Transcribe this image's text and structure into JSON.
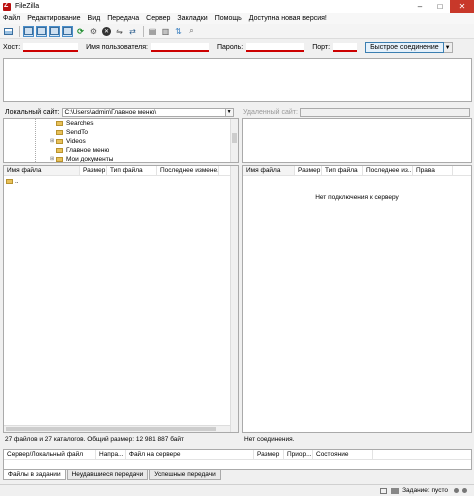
{
  "window": {
    "title": "FileZilla",
    "controls": [
      "–",
      "□",
      "✕"
    ]
  },
  "menu": [
    "Файл",
    "Редактирование",
    "Вид",
    "Передача",
    "Сервер",
    "Закладки",
    "Помощь",
    "Доступна новая версия!"
  ],
  "toolbar": {
    "icons": [
      "site-manager-icon",
      "message-log-icon",
      "local-tree-icon",
      "remote-tree-icon",
      "transfer-queue-icon",
      "refresh-icon",
      "process-queue-icon",
      "cancel-icon",
      "disconnect-icon",
      "reconnect-icon",
      "filter-icon",
      "compare-icon",
      "sync-browse-icon",
      "search-icon"
    ]
  },
  "quickconnect": {
    "host_label": "Хост:",
    "user_label": "Имя пользователя:",
    "pass_label": "Пароль:",
    "port_label": "Порт:",
    "host_value": "",
    "user_value": "",
    "pass_value": "",
    "port_value": "",
    "button_label": "Быстрое соединение",
    "highlight_color": "#cc0000"
  },
  "local": {
    "site_label": "Локальный сайт:",
    "site_path": "C:\\Users\\admin\\Главное меню\\",
    "tree": [
      "Searches",
      "SendTo",
      "Videos",
      "Главное меню",
      "Мои документы"
    ],
    "tree_expanders": [
      "",
      "",
      "⊞",
      "",
      "⊞"
    ],
    "columns": [
      "Имя файла",
      "Размер",
      "Тип файла",
      "Последнее измене..."
    ],
    "rows": [
      ".."
    ],
    "status": "27 файлов и 27 каталогов. Общий размер: 12 981 887 байт"
  },
  "remote": {
    "site_label": "Удаленный сайт:",
    "site_path": "",
    "columns": [
      "Имя файла",
      "Размер",
      "Тип файла",
      "Последнее из...",
      "Права"
    ],
    "empty_message": "Нет подключения к серверу",
    "status": "Нет соединения."
  },
  "queue": {
    "columns": [
      "Сервер/Локальный файл",
      "Напра...",
      "Файл на сервере",
      "Размер",
      "Приор...",
      "Состояние"
    ],
    "tabs": [
      "Файлы в задании",
      "Неудавшиеся передачи",
      "Успешные передачи"
    ],
    "status_text": "Задание: пусто"
  }
}
